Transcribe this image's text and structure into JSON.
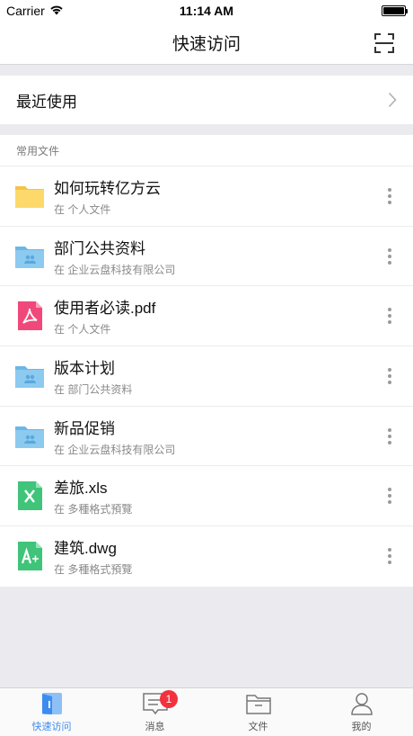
{
  "status_bar": {
    "carrier": "Carrier",
    "time": "11:14 AM",
    "battery_level": 1.0
  },
  "nav": {
    "title": "快速访问",
    "scan_icon": "scan-icon"
  },
  "recent": {
    "label": "最近使用",
    "chevron_icon": "chevron-right-icon"
  },
  "files_section": {
    "header": "常用文件",
    "items": [
      {
        "name": "如何玩转亿方云",
        "location": "在 个人文件",
        "icon": "folder-yellow-icon"
      },
      {
        "name": "部门公共资料",
        "location": "在 企业云盘科技有限公司",
        "icon": "shared-folder-icon"
      },
      {
        "name": "使用者必读.pdf",
        "location": "在 个人文件",
        "icon": "pdf-file-icon"
      },
      {
        "name": "版本计划",
        "location": "在 部门公共资料",
        "icon": "shared-folder-icon"
      },
      {
        "name": "新品促销",
        "location": "在 企业云盘科技有限公司",
        "icon": "shared-folder-icon"
      },
      {
        "name": "差旅.xls",
        "location": "在 多種格式預覽",
        "icon": "excel-file-icon"
      },
      {
        "name": "建筑.dwg",
        "location": "在 多種格式預覽",
        "icon": "dwg-file-icon"
      }
    ]
  },
  "tab_bar": {
    "tabs": [
      {
        "label": "快速访问",
        "icon": "quick-access-icon",
        "active": true
      },
      {
        "label": "消息",
        "icon": "message-icon",
        "badge": "1"
      },
      {
        "label": "文件",
        "icon": "files-icon"
      },
      {
        "label": "我的",
        "icon": "profile-icon"
      }
    ]
  },
  "colors": {
    "accent": "#3d8cf0",
    "badge": "#f2323c",
    "folder_yellow": "#fcd96a",
    "folder_blue": "#8ccaf0",
    "pdf": "#f0487a",
    "excel": "#3fc47a"
  }
}
